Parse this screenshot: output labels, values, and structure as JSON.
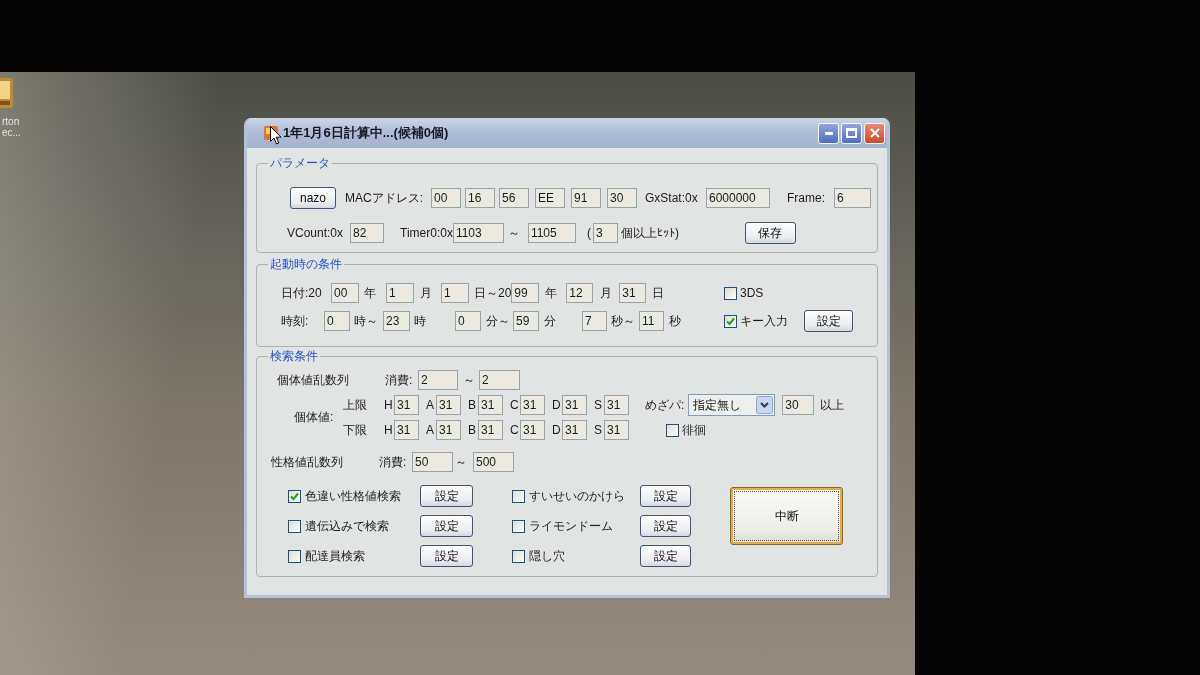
{
  "desktop": {
    "icon_label": [
      "rton",
      "ec..."
    ]
  },
  "window": {
    "title": "1年1月6日計算中...(候補0個)"
  },
  "parameters": {
    "title": "パラメータ",
    "rows": [
      {
        "items": [
          {
            "kind": "button",
            "text": "nazo"
          },
          {
            "kind": "label",
            "text": "MACアドレス:"
          },
          {
            "kind": "field",
            "value": "00"
          },
          {
            "kind": "field",
            "value": "16"
          },
          {
            "kind": "field",
            "value": "56"
          },
          {
            "kind": "field",
            "value": "EE"
          },
          {
            "kind": "field",
            "value": "91"
          },
          {
            "kind": "field",
            "value": "30"
          },
          {
            "kind": "label",
            "text": "GxStat:0x"
          },
          {
            "kind": "field",
            "value": "6000000"
          },
          {
            "kind": "label",
            "text": "Frame:"
          },
          {
            "kind": "field",
            "value": "6"
          }
        ]
      },
      {
        "items": [
          {
            "kind": "label",
            "text": "VCount:0x"
          },
          {
            "kind": "field",
            "value": "82"
          },
          {
            "kind": "label",
            "text": "Timer0:0x"
          },
          {
            "kind": "field",
            "value": "1103"
          },
          {
            "kind": "label",
            "text": "～"
          },
          {
            "kind": "field",
            "value": "1105"
          },
          {
            "kind": "label",
            "text": "("
          },
          {
            "kind": "field",
            "value": "3"
          },
          {
            "kind": "label",
            "text": "個以上ﾋｯﾄ)"
          },
          {
            "kind": "button",
            "text": "保存"
          }
        ]
      }
    ]
  },
  "startup": {
    "title": "起動時の条件",
    "rows": [
      {
        "items": [
          {
            "kind": "label",
            "text": "日付:20"
          },
          {
            "kind": "field",
            "value": "00"
          },
          {
            "kind": "label",
            "text": "年"
          },
          {
            "kind": "field",
            "value": "1"
          },
          {
            "kind": "label",
            "text": "月"
          },
          {
            "kind": "field",
            "value": "1"
          },
          {
            "kind": "label",
            "text": "日～20"
          },
          {
            "kind": "field",
            "value": "99"
          },
          {
            "kind": "label",
            "text": "年"
          },
          {
            "kind": "field",
            "value": "12"
          },
          {
            "kind": "label",
            "text": "月"
          },
          {
            "kind": "field",
            "value": "31"
          },
          {
            "kind": "label",
            "text": "日"
          }
        ],
        "side": [
          {
            "kind": "checkbox",
            "label": "3DS",
            "checked": false
          }
        ]
      },
      {
        "items": [
          {
            "kind": "label",
            "text": "時刻:"
          },
          {
            "kind": "field",
            "value": "0"
          },
          {
            "kind": "label",
            "text": "時～"
          },
          {
            "kind": "field",
            "value": "23"
          },
          {
            "kind": "label",
            "text": "時"
          },
          {
            "kind": "field",
            "value": "0"
          },
          {
            "kind": "label",
            "text": "分～"
          },
          {
            "kind": "field",
            "value": "59"
          },
          {
            "kind": "label",
            "text": "分"
          },
          {
            "kind": "field",
            "value": "7"
          },
          {
            "kind": "label",
            "text": "秒～"
          },
          {
            "kind": "field",
            "value": "11"
          },
          {
            "kind": "label",
            "text": "秒"
          }
        ],
        "side": [
          {
            "kind": "checkbox",
            "label": "キー入力",
            "checked": true
          },
          {
            "kind": "button",
            "text": "設定"
          }
        ]
      }
    ]
  },
  "search": {
    "title": "検索条件",
    "iv_rng": {
      "items": [
        {
          "kind": "label",
          "text": "個体値乱数列"
        },
        {
          "kind": "label",
          "text": "消費:"
        },
        {
          "kind": "field",
          "value": "2"
        },
        {
          "kind": "label",
          "text": "～"
        },
        {
          "kind": "field",
          "value": "2"
        }
      ]
    },
    "iv": {
      "label": "個体値:",
      "rows": [
        {
          "label": "上限",
          "stats": [
            {
              "name": "H",
              "value": "31"
            },
            {
              "name": "A",
              "value": "31"
            },
            {
              "name": "B",
              "value": "31"
            },
            {
              "name": "C",
              "value": "31"
            },
            {
              "name": "D",
              "value": "31"
            },
            {
              "name": "S",
              "value": "31"
            }
          ],
          "side": [
            {
              "kind": "label",
              "text": "めざパ:"
            },
            {
              "kind": "select",
              "value": "指定無し"
            },
            {
              "kind": "field",
              "value": "30"
            },
            {
              "kind": "label",
              "text": "以上"
            }
          ]
        },
        {
          "label": "下限",
          "stats": [
            {
              "name": "H",
              "value": "31"
            },
            {
              "name": "A",
              "value": "31"
            },
            {
              "name": "B",
              "value": "31"
            },
            {
              "name": "C",
              "value": "31"
            },
            {
              "name": "D",
              "value": "31"
            },
            {
              "name": "S",
              "value": "31"
            }
          ],
          "side": [
            {
              "kind": "checkbox",
              "label": "徘徊",
              "checked": false
            }
          ]
        }
      ]
    },
    "nature_rng": {
      "items": [
        {
          "kind": "label",
          "text": "性格値乱数列"
        },
        {
          "kind": "label",
          "text": "消費:"
        },
        {
          "kind": "field",
          "value": "50"
        },
        {
          "kind": "label",
          "text": "～"
        },
        {
          "kind": "field",
          "value": "500"
        }
      ]
    },
    "options": [
      [
        {
          "label": "色違い性格値検索",
          "checked": true,
          "button": "設定"
        },
        {
          "label": "遺伝込みで検索",
          "checked": false,
          "button": "設定"
        },
        {
          "label": "配達員検索",
          "checked": false,
          "button": "設定"
        }
      ],
      [
        {
          "label": "すいせいのかけら",
          "checked": false,
          "button": "設定"
        },
        {
          "label": "ライモンドーム",
          "checked": false,
          "button": "設定"
        },
        {
          "label": "隠し穴",
          "checked": false,
          "button": "設定"
        }
      ]
    ],
    "stop_button": {
      "text": "中断",
      "focused": true
    }
  }
}
